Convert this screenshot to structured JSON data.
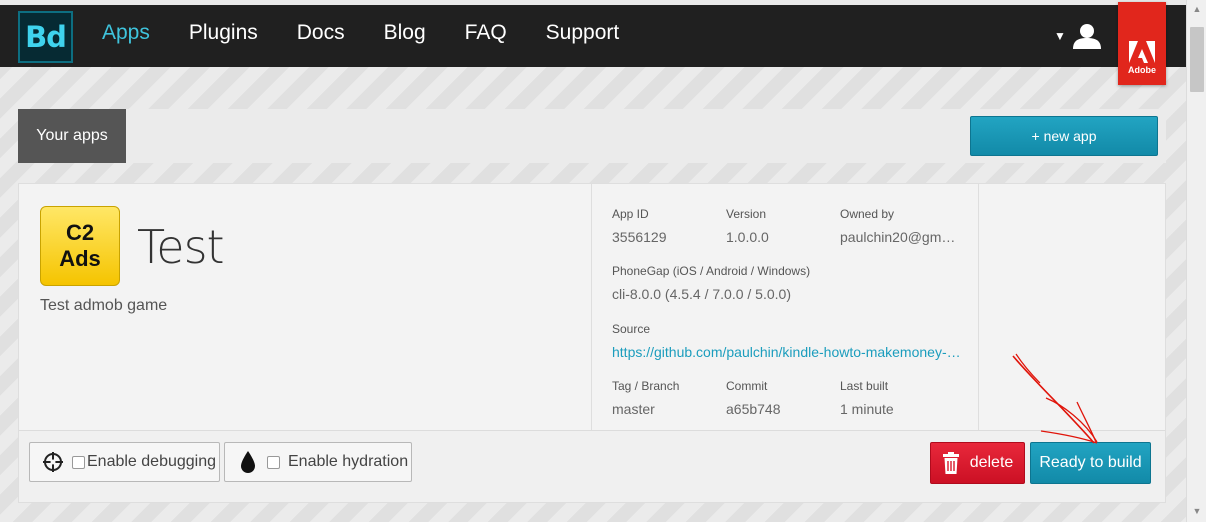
{
  "nav": {
    "logo": "Bd",
    "items": [
      {
        "label": "Apps",
        "active": true
      },
      {
        "label": "Plugins",
        "active": false
      },
      {
        "label": "Docs",
        "active": false
      },
      {
        "label": "Blog",
        "active": false
      },
      {
        "label": "FAQ",
        "active": false
      },
      {
        "label": "Support",
        "active": false
      }
    ],
    "user_icon": "user-icon",
    "adobe_label": "Adobe"
  },
  "section": {
    "tab_label": "Your apps",
    "new_app_label": "+ new app"
  },
  "app": {
    "icon_line1": "C2",
    "icon_line2": "Ads",
    "name": "Test",
    "description": "Test admob game",
    "details": {
      "app_id_label": "App ID",
      "app_id": "3556129",
      "version_label": "Version",
      "version": "1.0.0.0",
      "owner_label": "Owned by",
      "owner": "paulchin20@gm…",
      "phonegap_label": "PhoneGap (iOS / Android / Windows)",
      "phonegap": "cli-8.0.0 (4.5.4 / 7.0.0 / 5.0.0)",
      "source_label": "Source",
      "source": "https://github.com/paulchin/kindle-howto-makemoney-…",
      "tag_label": "Tag / Branch",
      "tag": "master",
      "commit_label": "Commit",
      "commit": "a65b748",
      "last_built_label": "Last built",
      "last_built": "1 minute"
    },
    "actions": {
      "debug_label": "Enable debugging",
      "hydration_label": "Enable hydration",
      "delete_label": "delete",
      "build_label": "Ready to build"
    }
  },
  "colors": {
    "accent": "#1b9dbd",
    "danger": "#e01e33",
    "annotation": "#e0140a"
  }
}
